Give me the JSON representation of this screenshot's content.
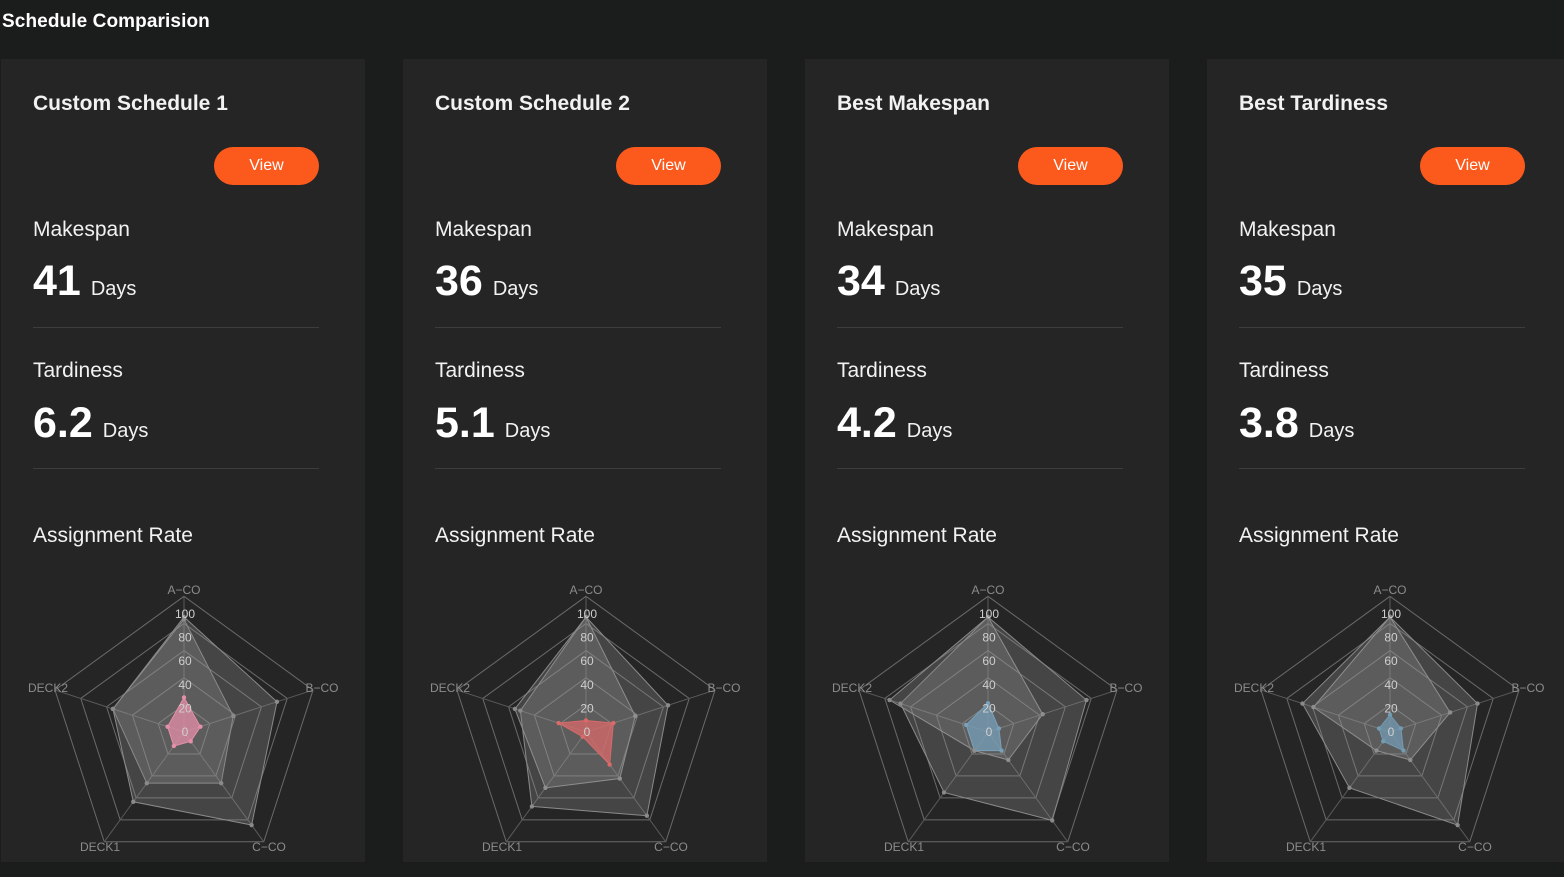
{
  "header": {
    "title": "Schedule Comparision"
  },
  "cards": [
    {
      "title": "Custom Schedule 1",
      "view_label": "View",
      "makespan_label": "Makespan",
      "makespan_value": "41",
      "makespan_unit": "Days",
      "tardiness_label": "Tardiness",
      "tardiness_value": "6.2",
      "tardiness_unit": "Days",
      "assignment_label": "Assignment Rate",
      "fill_color": "#e58fa8",
      "stroke_color": "#e58fa8"
    },
    {
      "title": "Custom Schedule 2",
      "view_label": "View",
      "makespan_label": "Makespan",
      "makespan_value": "36",
      "makespan_unit": "Days",
      "tardiness_label": "Tardiness",
      "tardiness_value": "5.1",
      "tardiness_unit": "Days",
      "assignment_label": "Assignment Rate",
      "fill_color": "#d96a6a",
      "stroke_color": "#d96a6a"
    },
    {
      "title": "Best Makespan",
      "view_label": "View",
      "makespan_label": "Makespan",
      "makespan_value": "34",
      "makespan_unit": "Days",
      "tardiness_label": "Tardiness",
      "tardiness_value": "4.2",
      "tardiness_unit": "Days",
      "assignment_label": "Assignment Rate",
      "fill_color": "#5ba6d6",
      "stroke_color": "#5ba6d6"
    },
    {
      "title": "Best Tardiness",
      "view_label": "View",
      "makespan_label": "Makespan",
      "makespan_value": "35",
      "makespan_unit": "Days",
      "tardiness_label": "Tardiness",
      "tardiness_value": "3.8",
      "tardiness_unit": "Days",
      "assignment_label": "Assignment Rate",
      "fill_color": "#4f9bc9",
      "stroke_color": "#4f9bc9"
    }
  ],
  "chart_data": [
    {
      "type": "radar",
      "axes": [
        "A−CO",
        "B−CO",
        "C−CO",
        "DECK1",
        "DECK2"
      ],
      "ticks": [
        "0",
        "20",
        "40",
        "60",
        "80",
        "100"
      ],
      "range": [
        0,
        100
      ],
      "series": [
        {
          "values": [
            30,
            15,
            10,
            15,
            15
          ]
        },
        {
          "values": [
            98,
            45,
            55,
            55,
            65
          ]
        },
        {
          "values": [
            100,
            85,
            100,
            75,
            65
          ]
        }
      ]
    },
    {
      "type": "radar",
      "axes": [
        "A−CO",
        "B−CO",
        "C−CO",
        "DECK1",
        "DECK2"
      ],
      "ticks": [
        "0",
        "20",
        "40",
        "60",
        "80",
        "100"
      ],
      "range": [
        0,
        100
      ],
      "series": [
        {
          "values": [
            10,
            25,
            35,
            5,
            25
          ]
        },
        {
          "values": [
            100,
            75,
            90,
            80,
            60
          ]
        },
        {
          "values": [
            100,
            45,
            50,
            60,
            65
          ]
        }
      ]
    },
    {
      "type": "radar",
      "axes": [
        "A−CO",
        "B−CO",
        "C−CO",
        "DECK1",
        "DECK2"
      ],
      "ticks": [
        "0",
        "20",
        "40",
        "60",
        "80",
        "100"
      ],
      "range": [
        0,
        100
      ],
      "series": [
        {
          "values": [
            100,
            90,
            95,
            65,
            80
          ]
        },
        {
          "values": [
            100,
            50,
            30,
            20,
            90
          ]
        },
        {
          "values": [
            25,
            10,
            20,
            20,
            20
          ]
        }
      ]
    },
    {
      "type": "radar",
      "axes": [
        "A−CO",
        "B−CO",
        "C−CO",
        "DECK1",
        "DECK2"
      ],
      "ticks": [
        "0",
        "20",
        "40",
        "60",
        "80",
        "100"
      ],
      "range": [
        0,
        100
      ],
      "series": [
        {
          "values": [
            100,
            80,
            100,
            60,
            80
          ]
        },
        {
          "values": [
            100,
            55,
            30,
            20,
            70
          ]
        },
        {
          "values": [
            15,
            10,
            20,
            10,
            10
          ]
        }
      ]
    }
  ]
}
